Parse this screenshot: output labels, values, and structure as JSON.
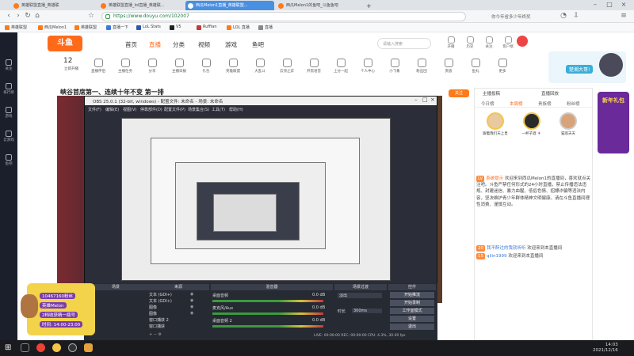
{
  "browser": {
    "tabs": [
      {
        "label": "英雄联盟直播_英雄联",
        "active": false
      },
      {
        "label": "英雄联盟直播_lol直播_英雄联...",
        "active": false
      },
      {
        "label": "西瓜Melon1直播_英雄联盟...",
        "active": true
      },
      {
        "label": "西瓜Melon1的鱼吧_斗鱼鱼吧",
        "active": false
      }
    ],
    "new_tab": "+",
    "url": "https://www.douyu.com/102007",
    "search_hint": "你今年省多少年终奖",
    "bookmarks": [
      "英雄联盟",
      "西瓜Melon1",
      "英雄联盟",
      "直播一下",
      "LoL Stats",
      "V5",
      "Ruffian",
      "LOL 直播",
      "直播"
    ]
  },
  "sidenav": [
    {
      "label": "关注"
    },
    {
      "label": "排行榜"
    },
    {
      "label": "游戏"
    },
    {
      "label": "云游戏"
    },
    {
      "label": "鱼吧"
    }
  ],
  "douyu": {
    "logo": "斗鱼",
    "nav": [
      {
        "label": "首页",
        "active": false
      },
      {
        "label": "直播",
        "active": true
      },
      {
        "label": "分类",
        "active": false
      },
      {
        "label": "视频",
        "active": false
      },
      {
        "label": "游戏",
        "active": false
      },
      {
        "label": "鱼吧",
        "active": false
      }
    ],
    "search_placeholder": "请输入搜索",
    "header_icons": [
      "开播",
      "历史",
      "关注",
      "客户端",
      "消息"
    ],
    "category_count": "12",
    "categories": [
      "立即开播",
      "直播伴侣",
      "主播任务",
      "分享",
      "主播日报",
      "礼包",
      "英雄联盟",
      "大乱斗",
      "云顶之弈",
      "开黑语音",
      "上分一起",
      "个人中心",
      "小飞象",
      "粉丝团",
      "贵族",
      "鱼丸",
      "更多"
    ],
    "promo_label": "楚湘大哥!",
    "stream_title": "峡谷首席第一、连续十年不变 第一排",
    "follow_button": "关注"
  },
  "obs": {
    "title": "OBS 25.0.1 (32-bit, windows) - 配置文件: 未命名 - 场景: 未命名",
    "menu": [
      "文件(F)",
      "编辑(E)",
      "视图(V)",
      "停靠部件(D)",
      "配置文件(P)",
      "场景集合(S)",
      "工具(T)",
      "帮助(H)"
    ],
    "docks": [
      "场景",
      "来源",
      "混音器",
      "场景过渡",
      "控件"
    ],
    "scenes": [
      "场景"
    ],
    "sources": [
      "文本 (GDI+)",
      "文本 (GDI+)",
      "图像",
      "图像",
      "窗口捕获 2",
      "窗口捕获"
    ],
    "mixer": [
      {
        "name": "桌面音频",
        "level": "0.0 dB"
      },
      {
        "name": "麦克风/Aux",
        "level": "0.0 dB"
      },
      {
        "name": "桌面音频 2",
        "level": "0.0 dB"
      }
    ],
    "transition": {
      "mode": "淡出",
      "duration_label": "时长",
      "duration": "300ms"
    },
    "controls": [
      "开始推流",
      "开始录制",
      "工作室模式",
      "设置",
      "退出"
    ],
    "status": "LIVE: 00:00:00  REC: 00:00:00  CPU: 4.3%, 30.00 fps"
  },
  "banner": {
    "lines": [
      "10467160粉丝",
      "英雄Melon",
      "2档收获精一瓶号",
      "时间: 14:00-23:00"
    ]
  },
  "right_panel": {
    "head_left": "主播投稿",
    "head_right": "直播回放",
    "tabs": [
      {
        "label": "今日榜",
        "active": false
      },
      {
        "label": "本周榜",
        "active": true
      },
      {
        "label": "贵族榜",
        "active": false
      },
      {
        "label": "粉丝榜",
        "active": false
      }
    ],
    "ranks": [
      {
        "name": "跟着我们天上皇",
        "tag": "1"
      },
      {
        "name": "一杯子酒 🍷",
        "tag": "2"
      },
      {
        "name": "猫巡天天",
        "tag": "3"
      }
    ],
    "chat": [
      {
        "level": "LV",
        "name": "系统提示",
        "text": "欢迎来到西瓜Melon1的直播间，喜欢就点关注吧。斗鱼严禁任何形式的24小时直播，禁止传播违法违规、封建迷信、暴力血腥、低俗色情、招嫖诈骗等违法内容，坚决维护青少年群体精神文明健康。请在斗鱼直播间理性消费、谨慎互动。"
      },
      {
        "level": "20",
        "name": "我不醉过的我就听听",
        "text": "欢迎来到本直播间"
      },
      {
        "level": "15",
        "name": "qilin1999",
        "text": "欢迎来到本直播间"
      }
    ],
    "gift_ad": "新年礼包"
  },
  "taskbar": {
    "time": "14:03",
    "date": "2021/12/16"
  }
}
